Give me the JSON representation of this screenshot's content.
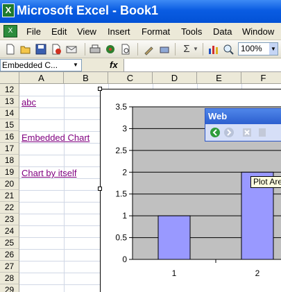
{
  "window": {
    "title": "Microsoft Excel - Book1"
  },
  "menu": [
    "File",
    "Edit",
    "View",
    "Insert",
    "Format",
    "Tools",
    "Data",
    "Window"
  ],
  "toolbar": {
    "zoom": "100%",
    "sigma": "Σ"
  },
  "formula_bar": {
    "name_box": "Embedded C...",
    "fx": "fx"
  },
  "columns": [
    "A",
    "B",
    "C",
    "D",
    "E",
    "F"
  ],
  "rows": [
    "12",
    "13",
    "14",
    "15",
    "16",
    "17",
    "18",
    "19",
    "20",
    "21",
    "22",
    "23",
    "24",
    "25",
    "26",
    "27",
    "28",
    "29"
  ],
  "cells": {
    "A13": "abc",
    "A16": "Embedded Chart",
    "A19": "Chart by itself"
  },
  "web_toolbar": {
    "title": "Web"
  },
  "tooltip": "Plot Area",
  "colors": {
    "plot_area": "#c0c0c0",
    "bar": "#9999ff",
    "link": "#800080"
  },
  "chart_data": {
    "type": "bar",
    "categories": [
      "1",
      "2"
    ],
    "series": [
      {
        "values": [
          1,
          2
        ]
      }
    ],
    "y_ticks": [
      "0",
      "0.5",
      "1",
      "1.5",
      "2",
      "2.5",
      "3",
      "3.5"
    ],
    "ylim": [
      0,
      3.5
    ],
    "grid": true
  }
}
